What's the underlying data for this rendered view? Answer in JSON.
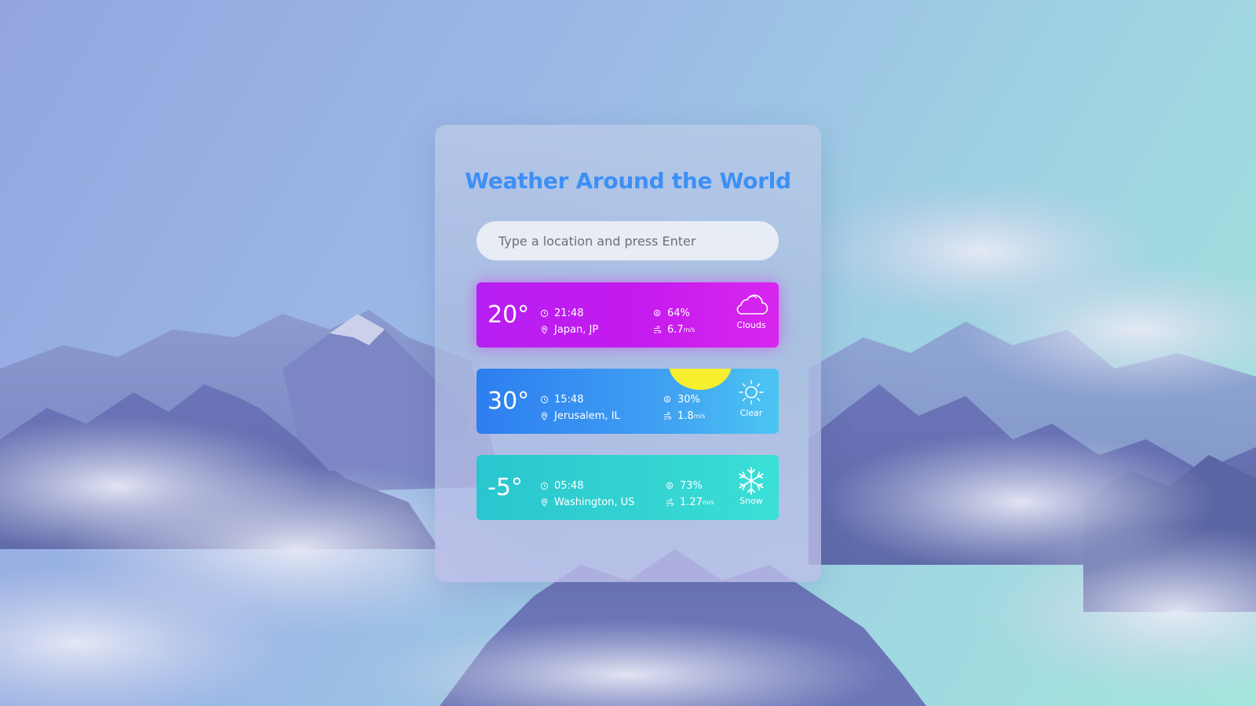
{
  "title": "Weather Around the World",
  "search": {
    "placeholder": "Type a location and press Enter"
  },
  "cards": [
    {
      "temperature": "20°",
      "time": "21:48",
      "location": "Japan, JP",
      "humidity": "64%",
      "wind": "6.7",
      "wind_unit": "m/s",
      "condition": "Clouds",
      "icon": "cloud-icon"
    },
    {
      "temperature": "30°",
      "time": "15:48",
      "location": "Jerusalem, IL",
      "humidity": "30%",
      "wind": "1.8",
      "wind_unit": "m/s",
      "condition": "Clear",
      "icon": "sun-icon"
    },
    {
      "temperature": "-5°",
      "time": "05:48",
      "location": "Washington, US",
      "humidity": "73%",
      "wind": "1.27",
      "wind_unit": "m/s",
      "condition": "Snow",
      "icon": "snowflake-icon"
    }
  ],
  "colors": {
    "title": "#3d8ff5",
    "clouds_card": "#c41aee",
    "clear_card": "#3f9ff2",
    "snow_card": "#35d4d2",
    "sun": "#f7ee2e"
  }
}
